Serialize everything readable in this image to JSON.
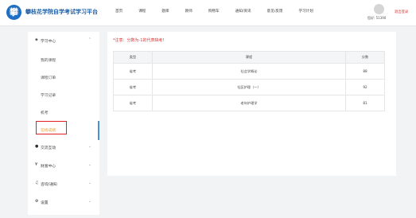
{
  "header": {
    "brand": "攀枝花学院自学考试学习平台",
    "nav": [
      "首页",
      "课程",
      "题库",
      "教师",
      "购物车",
      "通知/资讯",
      "意见/反馈",
      "学习计划"
    ],
    "user_id": "您好: 51390",
    "logout": "退出登录"
  },
  "sidebar": {
    "study_center": "学习中心",
    "study_items": [
      "我的课程",
      "课程订单",
      "学习记录",
      "机考",
      "在线成绩"
    ],
    "exchange": "交流互动",
    "finance": "财富中心",
    "consult": "咨询/通知",
    "settings": "设置"
  },
  "main": {
    "notice": "*注意：分数为-1的代表缺考!",
    "columns": [
      "类型",
      "课程",
      "分数"
    ],
    "rows": [
      {
        "type": "省考",
        "course": "社会学概论",
        "score": "88"
      },
      {
        "type": "省考",
        "course": "社区护理（一）",
        "score": "92"
      },
      {
        "type": "省考",
        "course": "老年护理学",
        "score": "81"
      }
    ]
  },
  "colors": {
    "accent": "#1f5fa8",
    "warning": "#e03030",
    "active": "#e8a13a"
  }
}
